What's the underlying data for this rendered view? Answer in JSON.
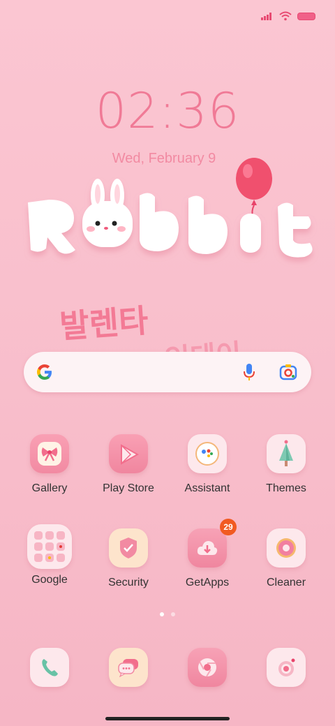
{
  "status": {
    "icons": [
      "signal-icon",
      "wifi-icon",
      "battery-icon"
    ]
  },
  "clock": {
    "time": "02:36",
    "date": "Wed, February 9"
  },
  "wallpaper": {
    "title": "Rabbit",
    "korean": "발렌타인데이"
  },
  "search": {
    "icons": [
      "google-logo-icon",
      "mic-icon",
      "lens-icon"
    ]
  },
  "apps": [
    {
      "label": "Gallery",
      "icon": "bow-icon"
    },
    {
      "label": "Play Store",
      "icon": "play-icon"
    },
    {
      "label": "Assistant",
      "icon": "assistant-icon"
    },
    {
      "label": "Themes",
      "icon": "tree-icon"
    },
    {
      "label": "Google",
      "icon": "folder-icon"
    },
    {
      "label": "Security",
      "icon": "shield-icon"
    },
    {
      "label": "GetApps",
      "icon": "cloud-download-icon",
      "badge": "29"
    },
    {
      "label": "Cleaner",
      "icon": "donut-icon"
    }
  ],
  "dock": [
    {
      "icon": "phone-icon"
    },
    {
      "icon": "messages-icon"
    },
    {
      "icon": "chrome-icon"
    },
    {
      "icon": "camera-icon"
    }
  ],
  "pages": {
    "current": 1,
    "total": 2
  }
}
